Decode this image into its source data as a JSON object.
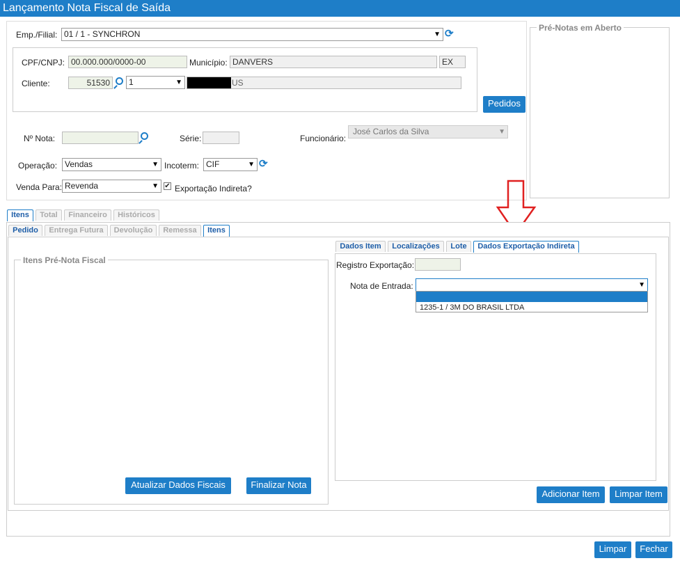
{
  "window": {
    "title": "Lançamento Nota Fiscal de Saída"
  },
  "header": {
    "emp_label": "Emp./Filial:",
    "emp_value": "01 / 1 - SYNCHRON",
    "cpf_label": "CPF/CNPJ:",
    "cpf_value": "00.000.000/0000-00",
    "municipio_label": "Município:",
    "municipio_value": "DANVERS",
    "uf_value": "EX",
    "cliente_label": "Cliente:",
    "cliente_code": "51530",
    "cliente_seq": "1",
    "cliente_name_suffix": "US",
    "pedidos_button": "Pedidos"
  },
  "nota": {
    "numero_label": "Nº Nota:",
    "numero_value": "",
    "serie_label": "Série:",
    "serie_value": "",
    "funcionario_label": "Funcionário:",
    "funcionario_value": "José Carlos da Silva",
    "operacao_label": "Operação:",
    "operacao_value": "Vendas",
    "incoterm_label": "Incoterm:",
    "incoterm_value": "CIF",
    "venda_label": "Venda Para:",
    "venda_value": "Revenda",
    "exportacao_label": "Exportação Indireta?",
    "exportacao_checked": "✔"
  },
  "pre_notas": {
    "legend": "Pré-Notas em Aberto"
  },
  "main_tabs": [
    {
      "label": "Itens"
    },
    {
      "label": "Total"
    },
    {
      "label": "Financeiro"
    },
    {
      "label": "Históricos"
    }
  ],
  "sub_tabs": [
    {
      "label": "Pedido"
    },
    {
      "label": "Entrega Futura"
    },
    {
      "label": "Devolução"
    },
    {
      "label": "Remessa"
    },
    {
      "label": "Itens"
    }
  ],
  "itens_pre_nota": {
    "legend": "Itens Pré-Nota Fiscal",
    "atualizar_button": "Atualizar Dados Fiscais",
    "finalizar_button": "Finalizar Nota"
  },
  "item_tabs": [
    {
      "label": "Dados Item"
    },
    {
      "label": "Localizações"
    },
    {
      "label": "Lote"
    },
    {
      "label": "Dados Exportação Indireta"
    }
  ],
  "exportacao": {
    "registro_label": "Registro Exportação:",
    "registro_value": "",
    "nota_entrada_label": "Nota de Entrada:",
    "nota_entrada_value": "",
    "options": [
      "",
      "1235-1 / 3M DO BRASIL LTDA"
    ]
  },
  "actions": {
    "adicionar": "Adicionar Item",
    "limpar_item": "Limpar Item",
    "limpar": "Limpar",
    "fechar": "Fechar"
  },
  "colors": {
    "accent": "#1e7ec8",
    "annotation_arrow": "#e02020"
  }
}
